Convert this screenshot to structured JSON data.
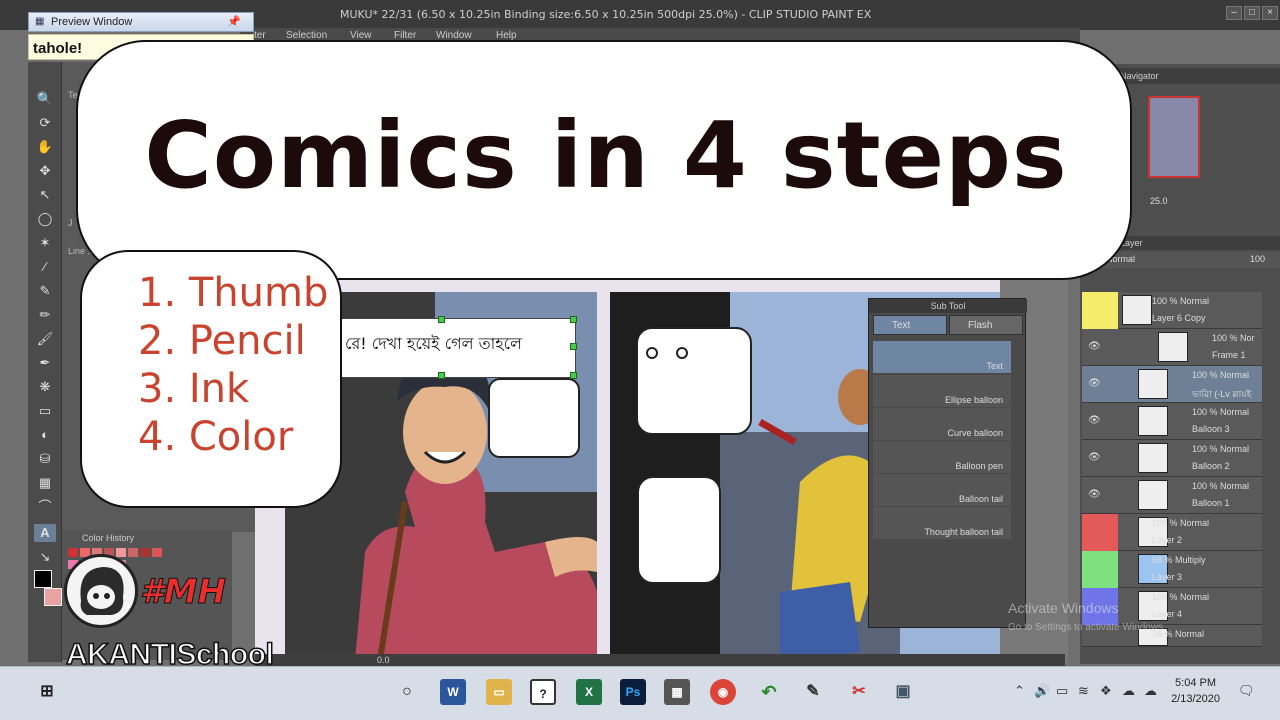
{
  "app": {
    "window_title": "MUKU* 22/31 (6.50 x 10.25in Binding size:6.50 x 10.25in 500dpi 25.0%) - CLIP STUDIO PAINT EX",
    "menu": [
      "ter",
      "Selection",
      "View",
      "Filter",
      "Window",
      "Help"
    ]
  },
  "preview_window": {
    "label": "Preview Window"
  },
  "tooltip_text": "tahole!",
  "tool_property": {
    "text_label": "Text",
    "line_label": "Line ...",
    "letter": "J"
  },
  "color_history": {
    "label": "Color History"
  },
  "canvas": {
    "bengali_text": "রে! দেখা হয়েই গেল তাহলে"
  },
  "subtool": {
    "header": "Sub Tool",
    "tabs": [
      "Text",
      "Flash"
    ],
    "items": [
      "Text",
      "Ellipse balloon",
      "Curve balloon",
      "Balloon pen",
      "Balloon tail",
      "Thought balloon tail"
    ]
  },
  "navigator": {
    "label": "Navigator",
    "zoom": "25.0"
  },
  "layer_panel": {
    "label": "Layer",
    "blend": "Normal",
    "opacity": "100",
    "layers": [
      {
        "props": "100 % Normal",
        "name": "Layer 6 Copy",
        "color": "#f5ec6c"
      },
      {
        "props": "100 % Nor",
        "name": "Frame 1",
        "color": ""
      },
      {
        "props": "100 % Normal",
        "name": "ভাৱিা (-Lv ল্লায়ই গাঁৰী Zvn|)",
        "color": ""
      },
      {
        "props": "100 % Normal",
        "name": "Balloon 3",
        "color": ""
      },
      {
        "props": "100 % Normal",
        "name": "Balloon 2",
        "color": ""
      },
      {
        "props": "100 % Normal",
        "name": "Balloon 1",
        "color": ""
      },
      {
        "props": "100 % Normal",
        "name": "Layer 2",
        "color": "#e45a5a"
      },
      {
        "props": "68 % Multiply",
        "name": "Layer 3",
        "color": "#7ee07e"
      },
      {
        "props": "100 % Normal",
        "name": "Layer 4",
        "color": "#6f74e8"
      },
      {
        "props": "26 % Normal",
        "name": "",
        "color": ""
      }
    ]
  },
  "watermark": {
    "line1": "Activate Windows",
    "line2": "Go to Settings to activate Windows."
  },
  "overlay": {
    "title": "Comics in 4 steps",
    "steps": [
      "1. Thumb",
      "2. Pencil",
      "3. Ink",
      "4. Color"
    ],
    "hashtag": "#MH",
    "brand": "AKANTISchool"
  },
  "footer": {
    "zoom_value": "0.0"
  },
  "taskbar": {
    "time": "5:04 PM",
    "date": "2/13/2020",
    "apps": [
      "word-icon",
      "folder-icon",
      "clip-studio-icon",
      "excel-icon",
      "photoshop-icon",
      "calculator-icon",
      "chrome-icon",
      "back-arrow-icon",
      "pen-icon",
      "snipping-icon",
      "screen-icon"
    ]
  },
  "colors": {
    "accent_red": "#c9442e",
    "hashtag_red": "#ea2d2d"
  }
}
